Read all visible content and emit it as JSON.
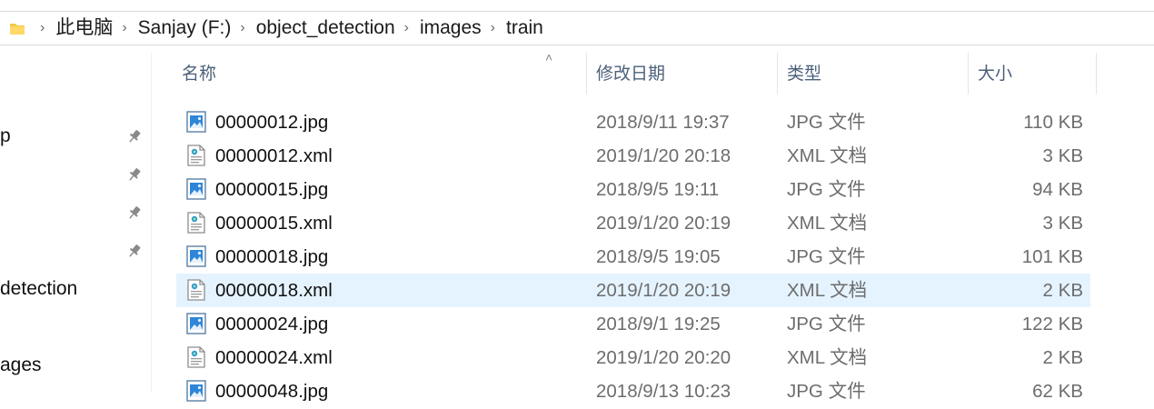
{
  "address_bar": {
    "path": [
      "此电脑",
      "Sanjay (F:)",
      "object_detection",
      "images",
      "train"
    ]
  },
  "nav_pane": {
    "items": [
      "p",
      "detection",
      "ages"
    ]
  },
  "columns": {
    "name": "名称",
    "date": "修改日期",
    "type": "类型",
    "size": "大小"
  },
  "files": [
    {
      "name": "00000012.jpg",
      "date": "2018/9/11 19:37",
      "type": "JPG 文件",
      "size": "110 KB",
      "icon": "image-file-icon"
    },
    {
      "name": "00000012.xml",
      "date": "2019/1/20 20:18",
      "type": "XML 文档",
      "size": "3 KB",
      "icon": "xml-file-icon"
    },
    {
      "name": "00000015.jpg",
      "date": "2018/9/5 19:11",
      "type": "JPG 文件",
      "size": "94 KB",
      "icon": "image-file-icon"
    },
    {
      "name": "00000015.xml",
      "date": "2019/1/20 20:19",
      "type": "XML 文档",
      "size": "3 KB",
      "icon": "xml-file-icon"
    },
    {
      "name": "00000018.jpg",
      "date": "2018/9/5 19:05",
      "type": "JPG 文件",
      "size": "101 KB",
      "icon": "image-file-icon"
    },
    {
      "name": "00000018.xml",
      "date": "2019/1/20 20:19",
      "type": "XML 文档",
      "size": "2 KB",
      "icon": "xml-file-icon",
      "selected": true
    },
    {
      "name": "00000024.jpg",
      "date": "2018/9/1 19:25",
      "type": "JPG 文件",
      "size": "122 KB",
      "icon": "image-file-icon"
    },
    {
      "name": "00000024.xml",
      "date": "2019/1/20 20:20",
      "type": "XML 文档",
      "size": "2 KB",
      "icon": "xml-file-icon"
    },
    {
      "name": "00000048.jpg",
      "date": "2018/9/13 10:23",
      "type": "JPG 文件",
      "size": "62 KB",
      "icon": "image-file-icon"
    }
  ],
  "colors": {
    "selected_row": "#e5f3ff",
    "header_text": "#4c607a",
    "folder_yellow": "#f3c845"
  }
}
